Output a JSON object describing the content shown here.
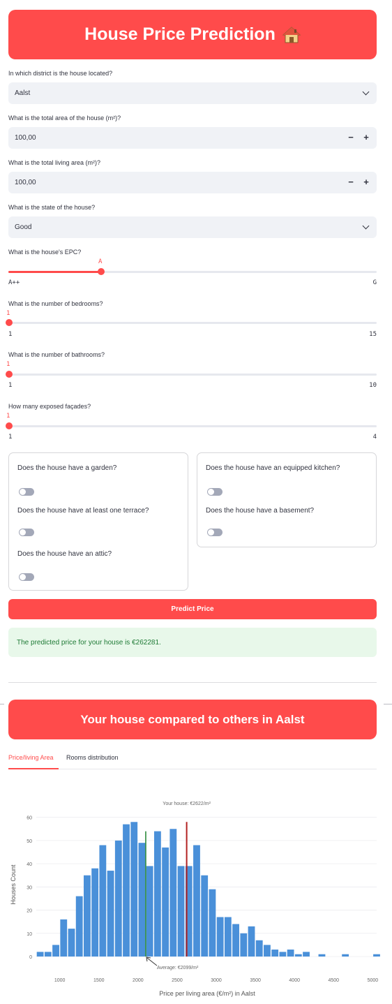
{
  "header": {
    "title": "House Price Prediction",
    "icon": "house-icon"
  },
  "form": {
    "district": {
      "label": "In which district is the house located?",
      "value": "Aalst"
    },
    "total_area": {
      "label": "What is the total area of the house (m²)?",
      "value": "100,00",
      "minus": "−",
      "plus": "+"
    },
    "living_area": {
      "label": "What is the total living area (m²)?",
      "value": "100,00",
      "minus": "−",
      "plus": "+"
    },
    "state": {
      "label": "What is the state of the house?",
      "value": "Good"
    },
    "epc": {
      "label": "What is the house's EPC?",
      "value": "A",
      "min": "A++",
      "max": "G",
      "fraction": 0.25
    },
    "bedrooms": {
      "label": "What is the number of bedrooms?",
      "value": "1",
      "min": "1",
      "max": "15",
      "fraction": 0
    },
    "bathrooms": {
      "label": "What is the number of bathrooms?",
      "value": "1",
      "min": "1",
      "max": "10",
      "fraction": 0
    },
    "facades": {
      "label": "How many exposed façades?",
      "value": "1",
      "min": "1",
      "max": "4",
      "fraction": 0
    },
    "toggles_left": [
      {
        "label": "Does the house have a garden?",
        "on": false
      },
      {
        "label": "Does the house have at least one terrace?",
        "on": false
      },
      {
        "label": "Does the house have an attic?",
        "on": false
      }
    ],
    "toggles_right": [
      {
        "label": "Does the house have an equipped kitchen?",
        "on": false
      },
      {
        "label": "Does the house have a basement?",
        "on": false
      }
    ],
    "predict_button": "Predict Price"
  },
  "result": {
    "message": "The predicted price for your house is €262281."
  },
  "comparison": {
    "title": "Your house compared to others in Aalst",
    "tabs": [
      {
        "label": "Price/living Area",
        "active": true
      },
      {
        "label": "Rooms distribution",
        "active": false
      }
    ]
  },
  "colors": {
    "accent": "#ff4b4b",
    "bar": "#4a90d9",
    "your_house_line": "#b22222",
    "average_line": "#2e8b3c"
  },
  "chart_data": {
    "type": "bar",
    "xlabel": "Price per living area (€/m²) in Aalst",
    "ylabel": "Houses Count",
    "xlim": [
      700,
      5050
    ],
    "ylim": [
      0,
      62
    ],
    "xticks": [
      1000,
      1500,
      2000,
      2500,
      3000,
      3500,
      4000,
      4500,
      5000
    ],
    "yticks": [
      0,
      10,
      20,
      30,
      40,
      50,
      60
    ],
    "bin_width": 100,
    "bins": [
      [
        750,
        2
      ],
      [
        850,
        2
      ],
      [
        950,
        5
      ],
      [
        1050,
        16
      ],
      [
        1150,
        12
      ],
      [
        1250,
        26
      ],
      [
        1350,
        35
      ],
      [
        1450,
        38
      ],
      [
        1550,
        48
      ],
      [
        1650,
        37
      ],
      [
        1750,
        50
      ],
      [
        1850,
        57
      ],
      [
        1950,
        58
      ],
      [
        2050,
        49
      ],
      [
        2150,
        39
      ],
      [
        2250,
        54
      ],
      [
        2350,
        47
      ],
      [
        2450,
        55
      ],
      [
        2550,
        39
      ],
      [
        2650,
        39
      ],
      [
        2750,
        48
      ],
      [
        2850,
        35
      ],
      [
        2950,
        29
      ],
      [
        3050,
        17
      ],
      [
        3150,
        17
      ],
      [
        3250,
        14
      ],
      [
        3350,
        10
      ],
      [
        3450,
        13
      ],
      [
        3550,
        7
      ],
      [
        3650,
        5
      ],
      [
        3750,
        3
      ],
      [
        3850,
        2
      ],
      [
        3950,
        3
      ],
      [
        4050,
        1
      ],
      [
        4150,
        2
      ],
      [
        4350,
        1
      ],
      [
        4650,
        1
      ],
      [
        5050,
        1
      ]
    ],
    "your_house": {
      "value": 2622,
      "label": "Your house: €2622/m²"
    },
    "average": {
      "value": 2099,
      "label": "Average: €2099/m²"
    }
  }
}
